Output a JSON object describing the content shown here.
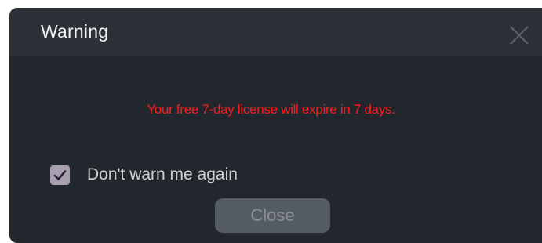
{
  "dialog": {
    "title": "Warning",
    "close_icon": "close-icon",
    "message": "Your free 7-day license will expire in 7 days.",
    "message_color": "#ff1a1a",
    "dont_warn": {
      "label": "Don't warn me again",
      "checked": true,
      "icon": "checkmark-icon"
    },
    "close_button_label": "Close"
  }
}
